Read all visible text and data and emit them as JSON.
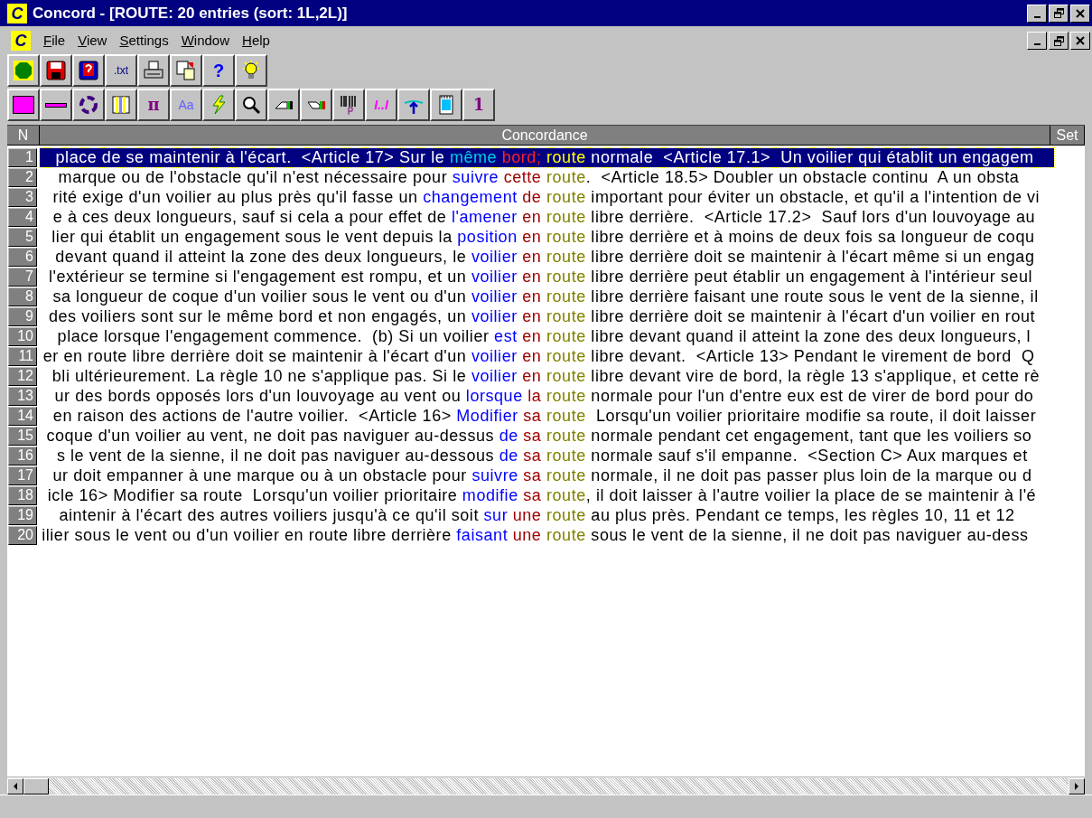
{
  "window": {
    "app_icon_letter": "C",
    "title": "Concord - [ROUTE: 20 entries (sort: 1L,2L)]"
  },
  "menu_bar": {
    "app_icon_letter": "C",
    "items": [
      "File",
      "View",
      "Settings",
      "Window",
      "Help"
    ]
  },
  "toolbars": [
    [
      {
        "kind": "icon"
      },
      {
        "kind": "icon"
      },
      {
        "kind": "icon"
      },
      {
        "kind": "text",
        "label": ".txt"
      },
      {
        "kind": "icon"
      },
      {
        "kind": "icon"
      },
      {
        "kind": "text",
        "label": "?"
      },
      {
        "kind": "icon"
      }
    ],
    [
      {
        "kind": "icon"
      },
      {
        "kind": "icon"
      },
      {
        "kind": "icon"
      },
      {
        "kind": "icon"
      },
      {
        "kind": "text",
        "label": "π"
      },
      {
        "kind": "text",
        "label": "Aa"
      },
      {
        "kind": "icon"
      },
      {
        "kind": "icon"
      },
      {
        "kind": "icon"
      },
      {
        "kind": "icon"
      },
      {
        "kind": "icon"
      },
      {
        "kind": "text",
        "label": "I..I"
      },
      {
        "kind": "icon"
      },
      {
        "kind": "icon"
      },
      {
        "kind": "text",
        "label": "1"
      }
    ]
  ],
  "table": {
    "columns": [
      "N",
      "Concordance",
      "Set"
    ],
    "rows": [
      {
        "n": "1",
        "selected": true,
        "left": "place de se maintenir à l'écart.  <Article 17> Sur le",
        "word_2": "même",
        "word_1": "bord;",
        "keyword": "route",
        "right": " normale  <Article 17.1>  Un voilier qui établit un engagem"
      },
      {
        "n": "2",
        "selected": false,
        "left": "marque ou de l'obstacle qu'il n'est nécessaire pour",
        "word_2": "suivre",
        "word_1": "cette",
        "keyword": "route",
        "right": ".  <Article 18.5> Doubler un obstacle continu  A un obsta"
      },
      {
        "n": "3",
        "selected": false,
        "left": "rité exige d'un voilier au plus près qu'il fasse un",
        "word_2": "changement",
        "word_1": "de",
        "keyword": "route",
        "right": " important pour éviter un obstacle, et qu'il a l'intention de vi"
      },
      {
        "n": "4",
        "selected": false,
        "left": "e à ces deux longueurs, sauf si cela a pour effet de",
        "word_2": "l'amener",
        "word_1": "en",
        "keyword": "route",
        "right": " libre derrière.  <Article 17.2>  Sauf lors d'un louvoyage au"
      },
      {
        "n": "5",
        "selected": false,
        "left": "lier qui établit un engagement sous le vent depuis la",
        "word_2": "position",
        "word_1": "en",
        "keyword": "route",
        "right": " libre derrière et à moins de deux fois sa longueur de coqu"
      },
      {
        "n": "6",
        "selected": false,
        "left": "devant quand il atteint la zone des deux longueurs, le",
        "word_2": "voilier",
        "word_1": "en",
        "keyword": "route",
        "right": " libre derrière doit se maintenir à l'écart même si un engag"
      },
      {
        "n": "7",
        "selected": false,
        "left": "l'extérieur se termine si l'engagement est rompu, et un",
        "word_2": "voilier",
        "word_1": "en",
        "keyword": "route",
        "right": " libre derrière peut établir un engagement à l'intérieur seul"
      },
      {
        "n": "8",
        "selected": false,
        "left": "sa longueur de coque d'un voilier sous le vent ou d'un",
        "word_2": "voilier",
        "word_1": "en",
        "keyword": "route",
        "right": " libre derrière faisant une route sous le vent de la sienne, il"
      },
      {
        "n": "9",
        "selected": false,
        "left": "des voiliers sont sur le même bord et non engagés, un",
        "word_2": "voilier",
        "word_1": "en",
        "keyword": "route",
        "right": " libre derrière doit se maintenir à l'écart d'un voilier en rout"
      },
      {
        "n": "10",
        "selected": false,
        "left": "place lorsque l'engagement commence.  (b) Si un voilier",
        "word_2": "est",
        "word_1": "en",
        "keyword": "route",
        "right": " libre devant quand il atteint la zone des deux longueurs, l"
      },
      {
        "n": "11",
        "selected": false,
        "left": "er en route libre derrière doit se maintenir à l'écart d'un",
        "word_2": "voilier",
        "word_1": "en",
        "keyword": "route",
        "right": " libre devant.  <Article 13> Pendant le virement de bord  Q"
      },
      {
        "n": "12",
        "selected": false,
        "left": "bli ultérieurement. La règle 10 ne s'applique pas. Si le",
        "word_2": "voilier",
        "word_1": "en",
        "keyword": "route",
        "right": " libre devant vire de bord, la règle 13 s'applique, et cette rè"
      },
      {
        "n": "13",
        "selected": false,
        "left": "ur des bords opposés lors d'un louvoyage au vent ou",
        "word_2": "lorsque",
        "word_1": "la",
        "keyword": "route",
        "right": " normale pour l'un d'entre eux est de virer de bord pour do"
      },
      {
        "n": "14",
        "selected": false,
        "left": "en raison des actions de l'autre voilier.  <Article 16>",
        "word_2": "Modifier",
        "word_1": "sa",
        "keyword": "route",
        "right": "  Lorsqu'un voilier prioritaire modifie sa route, il doit laisser"
      },
      {
        "n": "15",
        "selected": false,
        "left": "coque d'un voilier au vent, ne doit pas naviguer au-dessus",
        "word_2": "de",
        "word_1": "sa",
        "keyword": "route",
        "right": " normale pendant cet engagement, tant que les voiliers so"
      },
      {
        "n": "16",
        "selected": false,
        "left": "s le vent de la sienne, il ne doit pas naviguer au-dessous",
        "word_2": "de",
        "word_1": "sa",
        "keyword": "route",
        "right": " normale sauf s'il empanne.  <Section C> Aux marques et"
      },
      {
        "n": "17",
        "selected": false,
        "left": "ur doit empanner à une marque ou à un obstacle pour",
        "word_2": "suivre",
        "word_1": "sa",
        "keyword": "route",
        "right": " normale, il ne doit pas passer plus loin de la marque ou d"
      },
      {
        "n": "18",
        "selected": false,
        "left": "icle 16> Modifier sa route  Lorsqu'un voilier prioritaire",
        "word_2": "modifie",
        "word_1": "sa",
        "keyword": "route",
        "right": ", il doit laisser à l'autre voilier la place de se maintenir à l'é"
      },
      {
        "n": "19",
        "selected": false,
        "left": "aintenir à l'écart des autres voiliers jusqu'à ce qu'il soit",
        "word_2": "sur",
        "word_1": "une",
        "keyword": "route",
        "right": " au plus près. Pendant ce temps, les règles 10, 11 et 12"
      },
      {
        "n": "20",
        "selected": false,
        "left": "ilier sous le vent ou d'un voilier en route libre derrière",
        "word_2": "faisant",
        "word_1": "une",
        "keyword": "route",
        "right": " sous le vent de la sienne, il ne doit pas naviguer au-dess"
      }
    ]
  }
}
